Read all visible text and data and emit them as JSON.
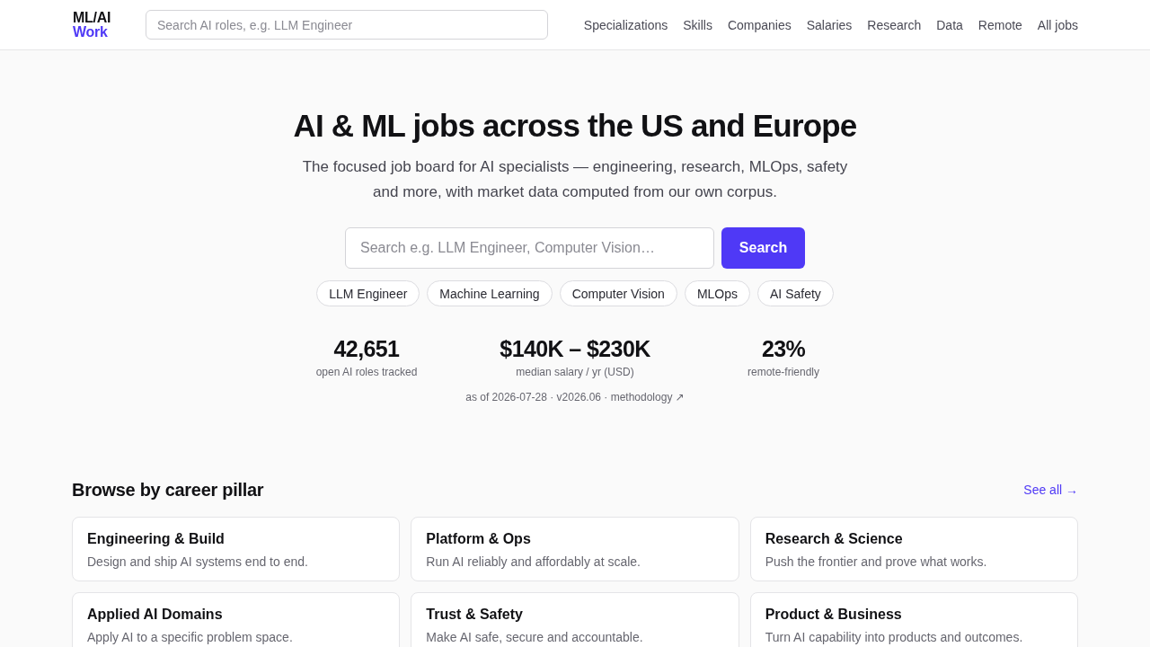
{
  "header": {
    "logo": {
      "line_1": "ML/AI",
      "line_2": "Work"
    },
    "search": {
      "placeholder": "Search AI roles, e.g. LLM Engineer"
    },
    "nav": [
      "Specializations",
      "Skills",
      "Companies",
      "Salaries",
      "Research",
      "Data",
      "Remote",
      "All jobs"
    ]
  },
  "hero": {
    "title": "AI & ML jobs across the US and Europe",
    "subtitle": "The focused job board for AI specialists — engineering, research, MLOps, safety and more, with market data computed from our own corpus.",
    "search": {
      "placeholder": "Search e.g. LLM Engineer, Computer Vision…"
    },
    "search_button": "Search",
    "chips": [
      "LLM Engineer",
      "Machine Learning",
      "Computer Vision",
      "MLOps",
      "AI Safety"
    ],
    "stats": [
      {
        "value": "42,651",
        "label": "open AI roles tracked"
      },
      {
        "value": "$140K – $230K",
        "label": "median salary / yr (USD)"
      },
      {
        "value": "23%",
        "label": "remote-friendly"
      }
    ],
    "meta": {
      "text": "as of 2026-07-28 · v2026.06 ·",
      "link": "methodology ↗"
    }
  },
  "pillars": {
    "title": "Browse by career pillar",
    "see_all": "See all →",
    "cards": [
      {
        "title": "Engineering & Build",
        "description": "Design and ship AI systems end to end."
      },
      {
        "title": "Platform & Ops",
        "description": "Run AI reliably and affordably at scale."
      },
      {
        "title": "Research & Science",
        "description": "Push the frontier and prove what works."
      },
      {
        "title": "Applied AI Domains",
        "description": "Apply AI to a specific problem space."
      },
      {
        "title": "Trust & Safety",
        "description": "Make AI safe, secure and accountable."
      },
      {
        "title": "Product & Business",
        "description": "Turn AI capability into products and outcomes."
      }
    ]
  }
}
